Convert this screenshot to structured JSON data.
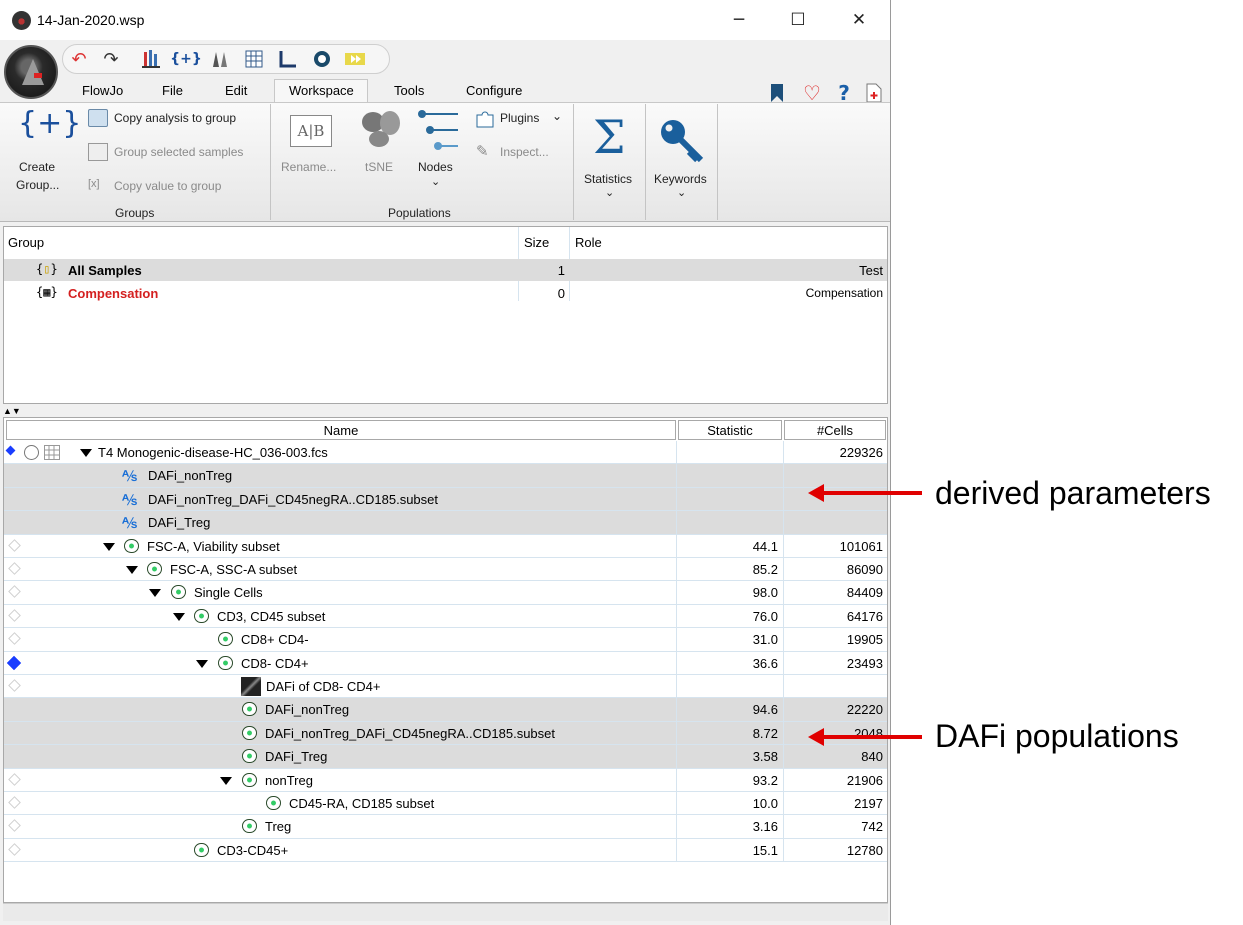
{
  "window": {
    "title": "14-Jan-2020.wsp"
  },
  "window_controls": {
    "minimize": "─",
    "maximize": "☐",
    "close": "✕"
  },
  "menu": {
    "items": [
      "FlowJo",
      "File",
      "Edit",
      "Workspace",
      "Tools",
      "Configure"
    ],
    "active": "Workspace"
  },
  "ribbon": {
    "groups_section": {
      "label": "Groups",
      "create_group_icon": "{+}",
      "create_group_label_1": "Create",
      "create_group_label_2": "Group...",
      "copy_analysis": "Copy analysis to group",
      "group_selected": "Group selected samples",
      "copy_value": "Copy value to group"
    },
    "populations_section": {
      "label": "Populations",
      "rename": "Rename...",
      "tsne": "tSNE",
      "nodes": "Nodes",
      "plugins": "Plugins",
      "inspect": "Inspect..."
    },
    "statistics": "Statistics",
    "keywords": "Keywords"
  },
  "group_table": {
    "headers": {
      "group": "Group",
      "size": "Size",
      "role": "Role"
    },
    "rows": [
      {
        "name": "All Samples",
        "size": "1",
        "role": "Test",
        "color": "#000000"
      },
      {
        "name": "Compensation",
        "size": "0",
        "role": "Compensation",
        "color": "#d42020"
      }
    ]
  },
  "sample_table": {
    "headers": {
      "name": "Name",
      "statistic": "Statistic",
      "cells": "#Cells"
    },
    "rows": [
      {
        "name": "T4  Monogenic-disease-HC_036-003.fcs",
        "statistic": "",
        "cells": "229326",
        "icon": "sample-icon"
      },
      {
        "name": "DAFi_nonTreg",
        "statistic": "",
        "cells": "",
        "icon": "derived-parameter-icon"
      },
      {
        "name": "DAFi_nonTreg_DAFi_CD45negRA..CD185.subset",
        "statistic": "",
        "cells": "",
        "icon": "derived-parameter-icon"
      },
      {
        "name": "DAFi_Treg",
        "statistic": "",
        "cells": "",
        "icon": "derived-parameter-icon"
      },
      {
        "name": "FSC-A, Viability subset",
        "statistic": "44.1",
        "cells": "101061",
        "icon": "gate-icon"
      },
      {
        "name": "FSC-A, SSC-A subset",
        "statistic": "85.2",
        "cells": "86090",
        "icon": "gate-icon"
      },
      {
        "name": "Single Cells",
        "statistic": "98.0",
        "cells": "84409",
        "icon": "gate-icon"
      },
      {
        "name": "CD3, CD45 subset",
        "statistic": "76.0",
        "cells": "64176",
        "icon": "gate-icon"
      },
      {
        "name": "CD8+ CD4-",
        "statistic": "31.0",
        "cells": "19905",
        "icon": "gate-icon"
      },
      {
        "name": "CD8- CD4+",
        "statistic": "36.6",
        "cells": "23493",
        "icon": "gate-icon"
      },
      {
        "name": "DAFi of CD8- CD4+",
        "statistic": "",
        "cells": "",
        "icon": "dafi-plugin-icon"
      },
      {
        "name": "DAFi_nonTreg",
        "statistic": "94.6",
        "cells": "22220",
        "icon": "gate-icon"
      },
      {
        "name": "DAFi_nonTreg_DAFi_CD45negRA..CD185.subset",
        "statistic": "8.72",
        "cells": "2048",
        "icon": "gate-icon"
      },
      {
        "name": "DAFi_Treg",
        "statistic": "3.58",
        "cells": "840",
        "icon": "gate-icon"
      },
      {
        "name": "nonTreg",
        "statistic": "93.2",
        "cells": "21906",
        "icon": "gate-icon"
      },
      {
        "name": "CD45-RA, CD185 subset",
        "statistic": "10.0",
        "cells": "2197",
        "icon": "gate-icon"
      },
      {
        "name": "Treg",
        "statistic": "3.16",
        "cells": "742",
        "icon": "gate-icon"
      },
      {
        "name": "CD3-CD45+",
        "statistic": "15.1",
        "cells": "12780",
        "icon": "gate-icon"
      }
    ]
  },
  "annotations": {
    "derived": "derived parameters",
    "populations": "DAFi populations",
    "arrow_color": "#e00000"
  }
}
